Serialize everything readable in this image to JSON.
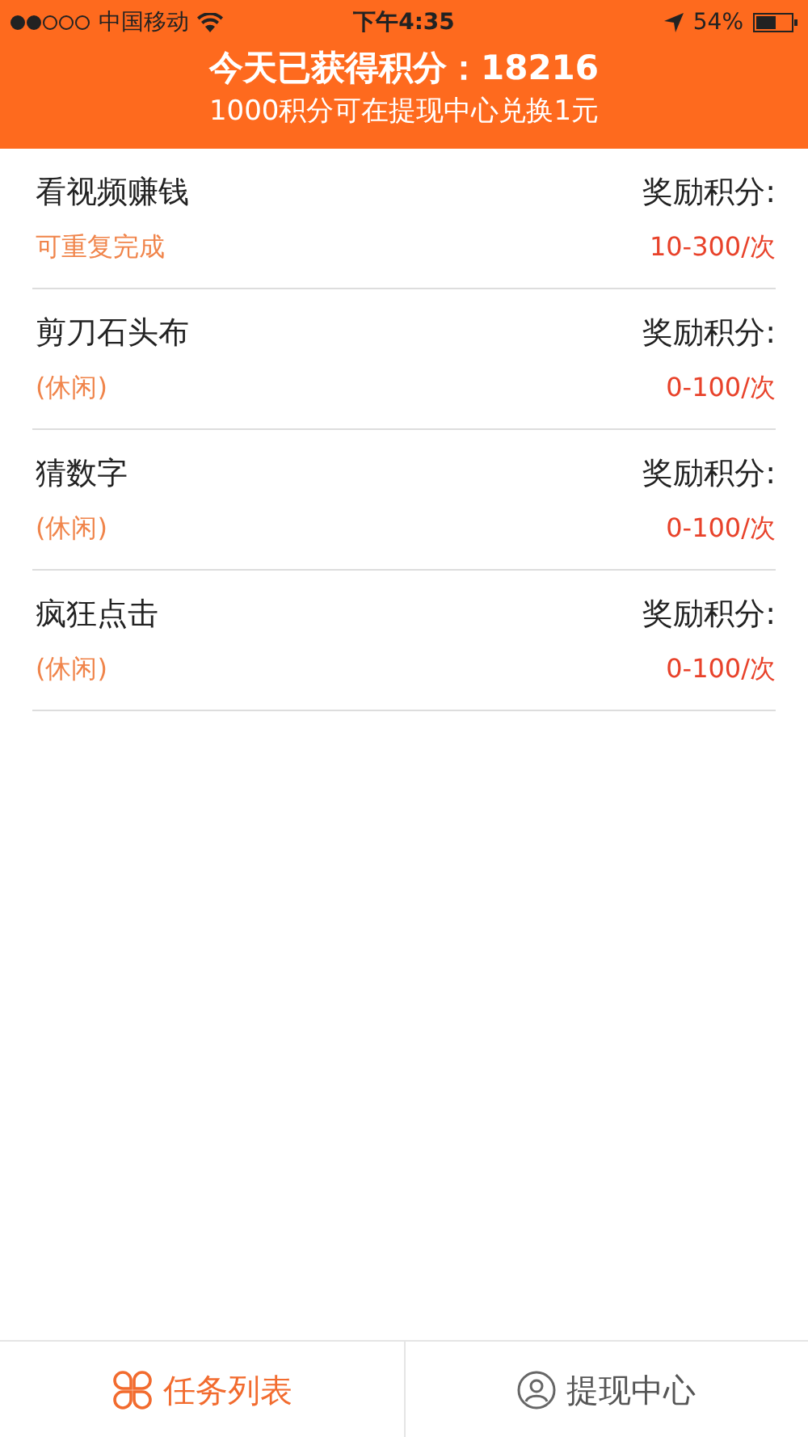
{
  "status_bar": {
    "carrier": "中国移动",
    "time": "下午4:35",
    "battery": "54%"
  },
  "header": {
    "title": "今天已获得积分：18216",
    "subtitle": "1000积分可在提现中心兑换1元"
  },
  "tasks": [
    {
      "name": "看视频赚钱",
      "tag": "可重复完成",
      "reward_label": "奖励积分:",
      "reward": "10-300/次"
    },
    {
      "name": "剪刀石头布",
      "tag": "(休闲)",
      "reward_label": "奖励积分:",
      "reward": "0-100/次"
    },
    {
      "name": "猜数字",
      "tag": "(休闲)",
      "reward_label": "奖励积分:",
      "reward": "0-100/次"
    },
    {
      "name": "疯狂点击",
      "tag": "(休闲)",
      "reward_label": "奖励积分:",
      "reward": "0-100/次"
    }
  ],
  "tabs": [
    {
      "label": "任务列表",
      "kind": "tasks",
      "selected": true
    },
    {
      "label": "提现中心",
      "kind": "user",
      "selected": false
    }
  ]
}
